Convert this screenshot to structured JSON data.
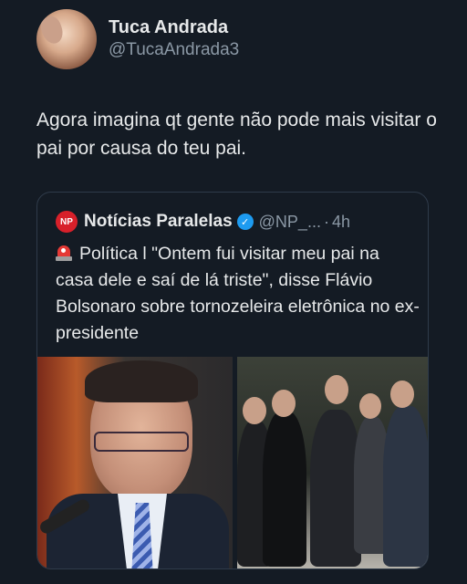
{
  "author": {
    "display_name": "Tuca Andrada",
    "handle": "@TucaAndrada3",
    "avatar_icon": "profile-photo"
  },
  "tweet": {
    "text": "Agora imagina qt gente não pode mais visitar o pai por causa do teu pai."
  },
  "quote": {
    "logo_text": "NP",
    "name": "Notícias Paralelas",
    "verified_icon": "verified-badge-icon",
    "handle": "@NP_...",
    "separator": "·",
    "time": "4h",
    "text": "Política l \"Ontem fui visitar meu pai na casa dele e saí de lá triste\", disse Flávio Bolsonaro sobre tornozeleira eletrônica no ex-presidente",
    "siren_icon": "rotating-light-emoji"
  },
  "colors": {
    "background": "#141b24",
    "text": "#e7e9ea",
    "muted": "#8b98a5",
    "verified": "#1d9bf0",
    "np_red": "#d8202a"
  }
}
